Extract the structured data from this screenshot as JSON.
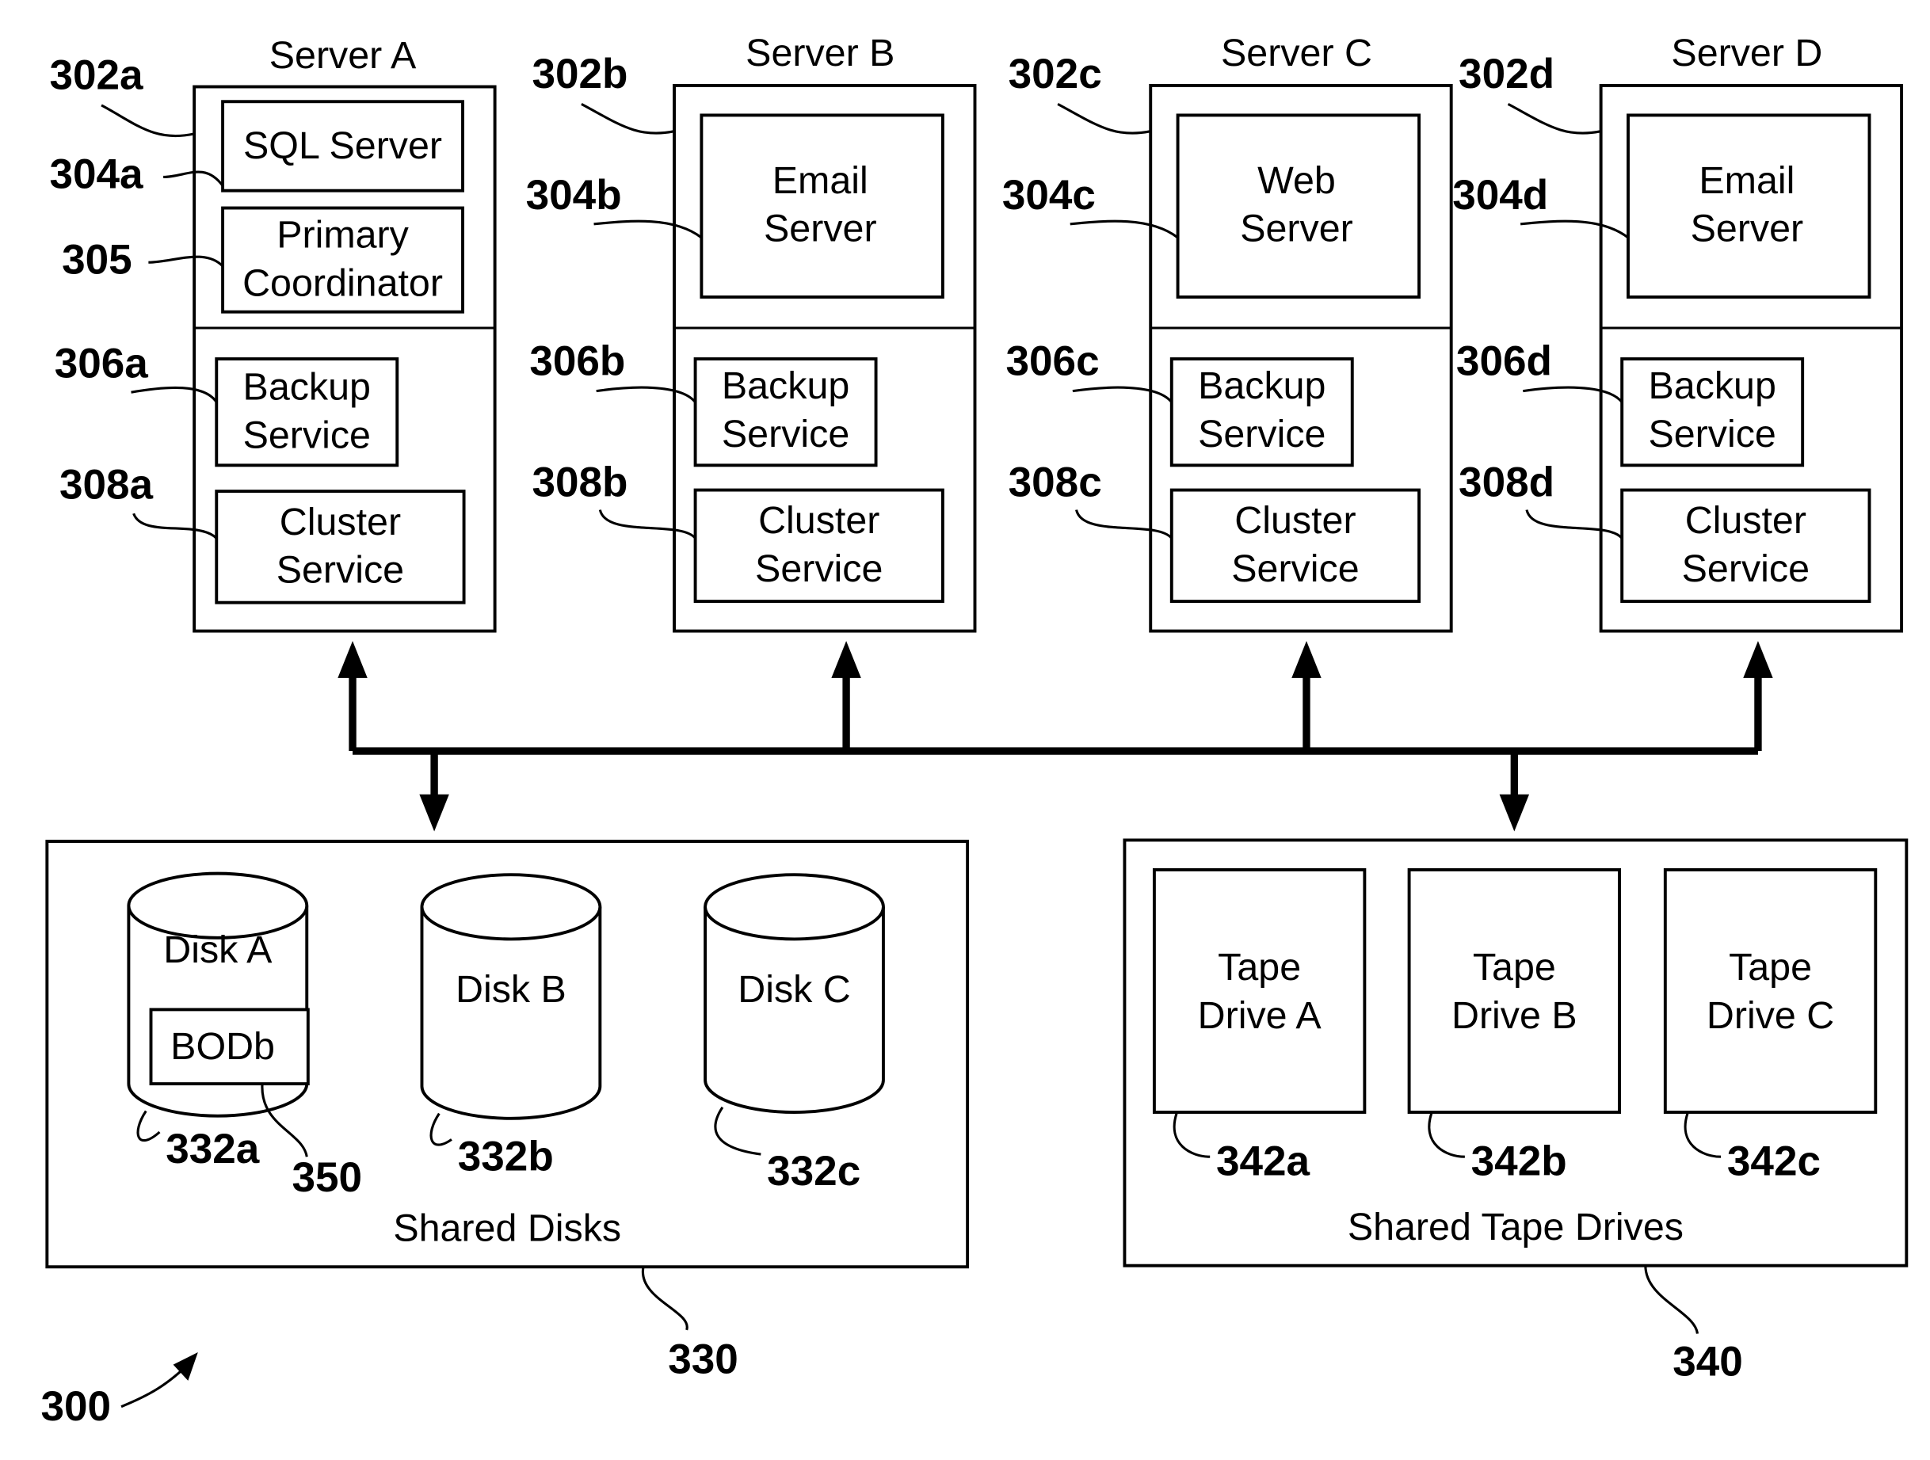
{
  "figure_ref": "300",
  "servers": [
    {
      "title": "Server A",
      "ref": "302a",
      "app_ref": "304a",
      "apps": [
        "SQL Server"
      ],
      "coord_ref": "305",
      "coord": [
        "Primary",
        "Coordinator"
      ],
      "backup_ref": "306a",
      "backup": [
        "Backup",
        "Service"
      ],
      "cluster_ref": "308a",
      "cluster": [
        "Cluster",
        "Service"
      ]
    },
    {
      "title": "Server B",
      "ref": "302b",
      "app_ref": "304b",
      "apps": [
        "Email",
        "Server"
      ],
      "backup_ref": "306b",
      "backup": [
        "Backup",
        "Service"
      ],
      "cluster_ref": "308b",
      "cluster": [
        "Cluster",
        "Service"
      ]
    },
    {
      "title": "Server C",
      "ref": "302c",
      "app_ref": "304c",
      "apps": [
        "Web",
        "Server"
      ],
      "backup_ref": "306c",
      "backup": [
        "Backup",
        "Service"
      ],
      "cluster_ref": "308c",
      "cluster": [
        "Cluster",
        "Service"
      ]
    },
    {
      "title": "Server D",
      "ref": "302d",
      "app_ref": "304d",
      "apps": [
        "Email",
        "Server"
      ],
      "backup_ref": "306d",
      "backup": [
        "Backup",
        "Service"
      ],
      "cluster_ref": "308d",
      "cluster": [
        "Cluster",
        "Service"
      ]
    }
  ],
  "shared_disks": {
    "label": "Shared Disks",
    "ref": "330",
    "disks": [
      {
        "name": "Disk A",
        "ref": "332a",
        "db": "BODb",
        "db_ref": "350"
      },
      {
        "name": "Disk B",
        "ref": "332b"
      },
      {
        "name": "Disk C",
        "ref": "332c"
      }
    ]
  },
  "shared_tapes": {
    "label": "Shared Tape Drives",
    "ref": "340",
    "drives": [
      {
        "name": [
          "Tape",
          "Drive A"
        ],
        "ref": "342a"
      },
      {
        "name": [
          "Tape",
          "Drive B"
        ],
        "ref": "342b"
      },
      {
        "name": [
          "Tape",
          "Drive C"
        ],
        "ref": "342c"
      }
    ]
  }
}
